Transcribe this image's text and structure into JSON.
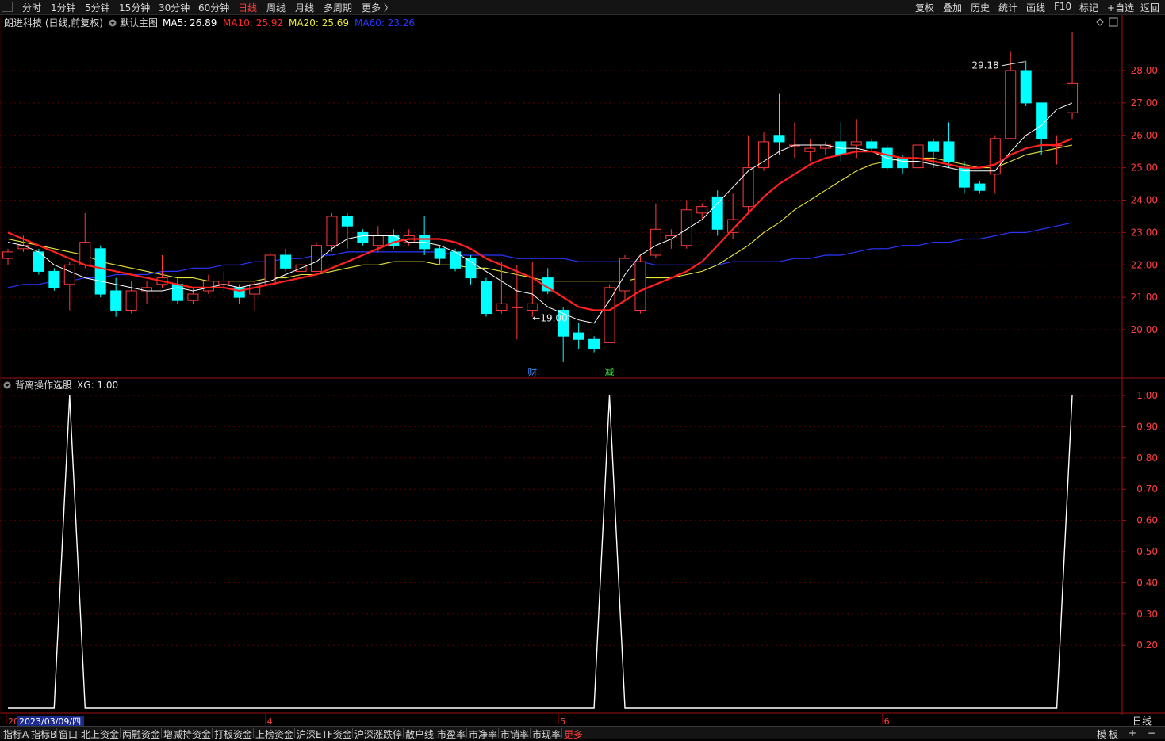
{
  "toolbar": {
    "left": [
      "分时",
      "1分钟",
      "5分钟",
      "15分钟",
      "30分钟",
      "60分钟",
      "日线",
      "周线",
      "月线",
      "多周期",
      "更多 〉"
    ],
    "active": "日线",
    "right": [
      "复权",
      "叠加",
      "历史",
      "统计",
      "画线",
      "F10",
      "标记",
      "+自选",
      "返回"
    ]
  },
  "main_header": {
    "title": "朗进科技 (日线,前复权)",
    "chart_name": "默认主图",
    "ma": [
      {
        "label": "MA5: 26.89",
        "color": "#ffffff"
      },
      {
        "label": "MA10: 25.92",
        "color": "#ff2a2a"
      },
      {
        "label": "MA20: 25.69",
        "color": "#e8e83a"
      },
      {
        "label": "MA60: 23.26",
        "color": "#2a36ff"
      }
    ]
  },
  "sub_header": {
    "title": "背离操作选股",
    "value": "XG: 1.00"
  },
  "colors": {
    "up": "#ff3a3a",
    "down": "#00ffff",
    "ma5": "#ffffff",
    "ma10": "#ff2020",
    "ma20": "#e8e83a",
    "ma60": "#2a36ff",
    "grid": "#5a0000",
    "axis": "#a01010"
  },
  "chart_data": [
    {
      "type": "candlestick",
      "title": "朗进科技 (日线,前复权)",
      "ylim": [
        19.3,
        29.7
      ],
      "yticks": [
        "28.00",
        "27.00",
        "26.00",
        "25.00",
        "24.00",
        "23.00",
        "22.00",
        "21.00",
        "20.00"
      ],
      "annotations": [
        {
          "text": "29.18",
          "kind": "high",
          "index": 66
        },
        {
          "text": "19.00",
          "kind": "low",
          "index": 34
        },
        {
          "text": "财",
          "index": 34
        },
        {
          "text": "减",
          "index": 39
        }
      ],
      "candles": [
        [
          22.2,
          22.4,
          22.0,
          22.5
        ],
        [
          22.5,
          22.6,
          22.4,
          22.9
        ],
        [
          22.4,
          21.8,
          21.7,
          22.5
        ],
        [
          21.8,
          21.3,
          21.2,
          21.9
        ],
        [
          21.4,
          22.0,
          20.6,
          22.1
        ],
        [
          22.0,
          22.7,
          21.9,
          23.6
        ],
        [
          22.5,
          21.1,
          21.0,
          22.6
        ],
        [
          21.2,
          20.6,
          20.4,
          21.6
        ],
        [
          20.6,
          21.2,
          20.5,
          21.5
        ],
        [
          21.2,
          21.3,
          20.8,
          21.5
        ],
        [
          21.4,
          21.6,
          21.3,
          22.3
        ],
        [
          21.4,
          20.9,
          20.8,
          21.6
        ],
        [
          20.9,
          21.1,
          20.8,
          21.3
        ],
        [
          21.2,
          21.5,
          21.1,
          21.7
        ],
        [
          21.4,
          21.5,
          21.2,
          21.8
        ],
        [
          21.3,
          21.0,
          20.8,
          21.4
        ],
        [
          21.1,
          21.4,
          20.6,
          21.5
        ],
        [
          21.4,
          22.3,
          21.3,
          22.4
        ],
        [
          22.3,
          21.9,
          21.8,
          22.5
        ],
        [
          21.8,
          22.0,
          21.7,
          22.3
        ],
        [
          21.8,
          22.6,
          21.8,
          22.7
        ],
        [
          22.6,
          23.5,
          22.4,
          23.6
        ],
        [
          23.5,
          23.2,
          22.5,
          23.6
        ],
        [
          23.0,
          22.7,
          22.6,
          23.1
        ],
        [
          22.6,
          22.9,
          22.4,
          23.2
        ],
        [
          22.9,
          22.6,
          22.5,
          23.1
        ],
        [
          22.7,
          22.9,
          22.6,
          23.1
        ],
        [
          22.9,
          22.5,
          22.3,
          23.5
        ],
        [
          22.5,
          22.2,
          22.0,
          22.6
        ],
        [
          22.4,
          21.9,
          21.8,
          22.5
        ],
        [
          22.2,
          21.6,
          21.4,
          22.3
        ],
        [
          21.5,
          20.5,
          20.4,
          21.6
        ],
        [
          20.6,
          20.8,
          20.5,
          22.1
        ],
        [
          20.7,
          20.7,
          19.7,
          22.0
        ],
        [
          20.6,
          20.8,
          20.4,
          22.1
        ],
        [
          21.6,
          21.2,
          21.1,
          21.9
        ],
        [
          20.6,
          19.8,
          19.0,
          20.7
        ],
        [
          19.9,
          19.7,
          19.4,
          20.2
        ],
        [
          19.7,
          19.4,
          19.3,
          19.8
        ],
        [
          19.6,
          21.3,
          19.6,
          21.4
        ],
        [
          21.2,
          22.2,
          20.9,
          22.3
        ],
        [
          20.6,
          22.1,
          20.5,
          22.3
        ],
        [
          22.3,
          23.1,
          22.2,
          23.9
        ],
        [
          22.8,
          22.9,
          22.5,
          23.1
        ],
        [
          22.6,
          23.7,
          22.5,
          24.0
        ],
        [
          23.6,
          23.8,
          23.4,
          23.9
        ],
        [
          24.1,
          23.1,
          22.9,
          24.3
        ],
        [
          23.0,
          23.4,
          22.8,
          24.2
        ],
        [
          23.8,
          25.0,
          23.6,
          26.0
        ],
        [
          25.0,
          25.8,
          24.9,
          26.1
        ],
        [
          26.0,
          25.8,
          25.4,
          27.3
        ],
        [
          25.7,
          25.7,
          25.3,
          26.4
        ],
        [
          25.5,
          25.6,
          25.2,
          25.9
        ],
        [
          25.6,
          25.7,
          25.4,
          25.8
        ],
        [
          25.8,
          25.4,
          25.2,
          26.4
        ],
        [
          25.7,
          25.8,
          25.3,
          26.5
        ],
        [
          25.8,
          25.6,
          25.5,
          25.9
        ],
        [
          25.6,
          25.0,
          24.9,
          25.7
        ],
        [
          25.3,
          25.0,
          24.8,
          25.4
        ],
        [
          25.0,
          25.7,
          24.9,
          26.0
        ],
        [
          25.8,
          25.5,
          25.0,
          25.9
        ],
        [
          25.8,
          25.2,
          25.0,
          26.4
        ],
        [
          25.0,
          24.4,
          24.2,
          25.2
        ],
        [
          24.5,
          24.3,
          24.2,
          24.6
        ],
        [
          24.8,
          25.9,
          24.2,
          26.0
        ],
        [
          25.9,
          28.0,
          25.9,
          28.6
        ],
        [
          28.0,
          27.0,
          26.9,
          28.3
        ],
        [
          27.0,
          25.9,
          25.4,
          27.0
        ],
        [
          25.7,
          25.7,
          25.1,
          26.0
        ],
        [
          26.7,
          27.6,
          26.5,
          29.18
        ]
      ],
      "ma5": [
        22.7,
        22.6,
        22.4,
        22.0,
        21.8,
        21.6,
        21.5,
        21.4,
        21.3,
        21.2,
        21.2,
        21.3,
        21.2,
        21.3,
        21.4,
        21.3,
        21.4,
        21.5,
        21.7,
        21.9,
        22.1,
        22.5,
        22.8,
        22.9,
        22.9,
        22.9,
        22.7,
        22.7,
        22.6,
        22.4,
        22.1,
        21.8,
        21.5,
        21.2,
        21.1,
        20.7,
        20.5,
        20.3,
        20.2,
        20.9,
        21.7,
        22.3,
        22.6,
        22.8,
        23.1,
        23.4,
        23.9,
        24.4,
        24.9,
        25.2,
        25.5,
        25.7,
        25.7,
        25.7,
        25.6,
        25.6,
        25.5,
        25.3,
        25.2,
        25.2,
        25.1,
        25.0,
        24.9,
        24.9,
        24.9,
        25.5,
        26.0,
        26.3,
        26.8,
        27.0
      ],
      "ma10": [
        23.0,
        22.8,
        22.6,
        22.4,
        22.2,
        22.0,
        21.9,
        21.8,
        21.7,
        21.6,
        21.5,
        21.4,
        21.3,
        21.3,
        21.3,
        21.2,
        21.3,
        21.4,
        21.5,
        21.6,
        21.7,
        21.9,
        22.1,
        22.3,
        22.5,
        22.7,
        22.8,
        22.8,
        22.8,
        22.7,
        22.5,
        22.2,
        22.0,
        21.8,
        21.6,
        21.3,
        21.0,
        20.7,
        20.6,
        20.6,
        20.9,
        21.2,
        21.4,
        21.6,
        21.8,
        22.1,
        22.6,
        23.1,
        23.6,
        24.1,
        24.5,
        24.8,
        25.1,
        25.3,
        25.4,
        25.5,
        25.5,
        25.4,
        25.3,
        25.3,
        25.2,
        25.1,
        25.0,
        25.0,
        25.1,
        25.4,
        25.6,
        25.7,
        25.7,
        25.9
      ],
      "ma20": [
        22.8,
        22.7,
        22.6,
        22.5,
        22.4,
        22.3,
        22.1,
        22.0,
        21.9,
        21.8,
        21.7,
        21.6,
        21.6,
        21.5,
        21.5,
        21.5,
        21.5,
        21.6,
        21.6,
        21.7,
        21.7,
        21.8,
        21.9,
        22.0,
        22.0,
        22.1,
        22.1,
        22.1,
        22.0,
        22.0,
        21.9,
        21.9,
        21.8,
        21.7,
        21.6,
        21.5,
        21.5,
        21.5,
        21.5,
        21.5,
        21.5,
        21.6,
        21.6,
        21.6,
        21.7,
        21.8,
        22.0,
        22.3,
        22.6,
        23.0,
        23.3,
        23.7,
        24.0,
        24.3,
        24.6,
        24.9,
        25.1,
        25.2,
        25.3,
        25.3,
        25.3,
        25.2,
        25.1,
        25.0,
        25.0,
        25.2,
        25.4,
        25.5,
        25.6,
        25.7
      ],
      "ma60": [
        21.3,
        21.4,
        21.4,
        21.5,
        21.5,
        21.6,
        21.6,
        21.7,
        21.7,
        21.7,
        21.8,
        21.8,
        21.9,
        21.9,
        22.0,
        22.0,
        22.1,
        22.1,
        22.2,
        22.2,
        22.3,
        22.3,
        22.4,
        22.4,
        22.4,
        22.4,
        22.4,
        22.4,
        22.4,
        22.3,
        22.3,
        22.3,
        22.3,
        22.2,
        22.2,
        22.2,
        22.2,
        22.1,
        22.1,
        22.1,
        22.1,
        22.1,
        22.0,
        22.0,
        22.0,
        22.0,
        22.0,
        22.1,
        22.1,
        22.1,
        22.1,
        22.2,
        22.2,
        22.3,
        22.3,
        22.4,
        22.5,
        22.5,
        22.6,
        22.6,
        22.7,
        22.7,
        22.8,
        22.8,
        22.9,
        23.0,
        23.0,
        23.1,
        23.2,
        23.3
      ]
    },
    {
      "type": "line",
      "title": "背离操作选股",
      "series_name": "XG",
      "ylim": [
        0,
        1.05
      ],
      "yticks": [
        "1.00",
        "0.90",
        "0.80",
        "0.70",
        "0.60",
        "0.50",
        "0.40",
        "0.30",
        "0.20"
      ],
      "peaks_at_index": [
        4,
        39,
        69
      ]
    }
  ],
  "x_axis": {
    "date_label": "2023/03/09/四",
    "month_labels": [
      {
        "text": "20",
        "index": 0
      },
      {
        "text": "4",
        "index": 17
      },
      {
        "text": "5",
        "index": 36
      },
      {
        "text": "6",
        "index": 57
      }
    ],
    "period_label": "日线"
  },
  "bottom_tabs": [
    "指标A",
    "指标B",
    "窗口",
    "北上资金",
    "两融资金",
    "增减持资金",
    "打板资金",
    "上榜资金",
    "沪深ETF资金",
    "沪深涨跌停",
    "散户线",
    "市盈率",
    "市净率",
    "市销率",
    "市现率",
    "更多"
  ],
  "bottom_right": [
    "模",
    "板",
    "+",
    "−"
  ]
}
